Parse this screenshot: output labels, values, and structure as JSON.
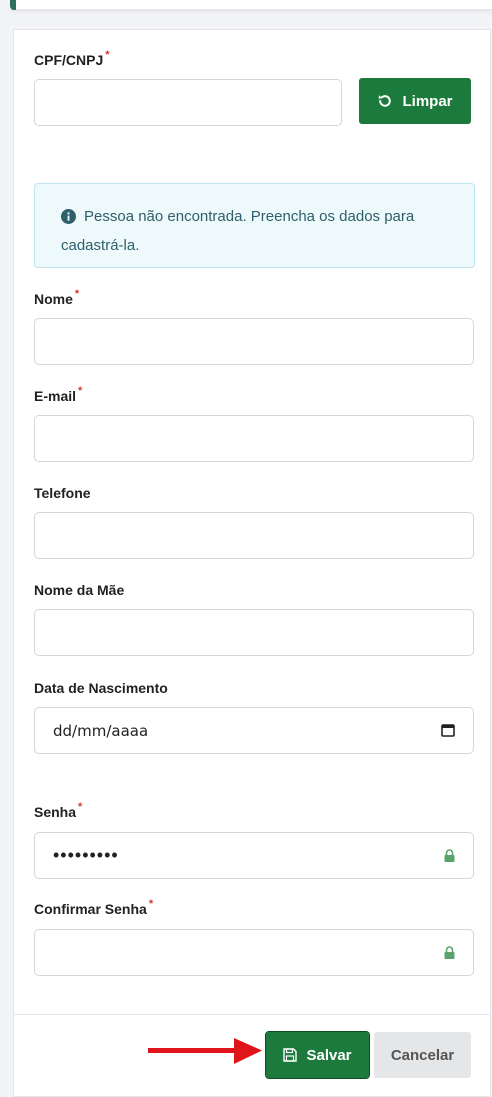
{
  "form": {
    "cpf_label": "CPF/CNPJ",
    "cpf_value": "",
    "limpar_label": "Limpar",
    "alert_text": "Pessoa não encontrada. Preencha os dados para cadastrá-la.",
    "nome_label": "Nome",
    "email_label": "E-mail",
    "telefone_label": "Telefone",
    "nome_mae_label": "Nome da Mãe",
    "data_nascimento_label": "Data de Nascimento",
    "data_nascimento_placeholder": "dd/mm/aaaa",
    "senha_label": "Senha",
    "senha_value": "•••••••••",
    "confirmar_senha_label": "Confirmar Senha",
    "required_marker": "*"
  },
  "footer": {
    "salvar_label": "Salvar",
    "cancelar_label": "Cancelar"
  },
  "colors": {
    "primary": "#1c7a3c",
    "required": "#d9362b",
    "alert_bg": "#eef9fc",
    "arrow": "#e0151b"
  },
  "icons": [
    "refresh-icon",
    "info-icon",
    "calendar-icon",
    "lock-icon",
    "save-icon",
    "arrow-icon"
  ]
}
